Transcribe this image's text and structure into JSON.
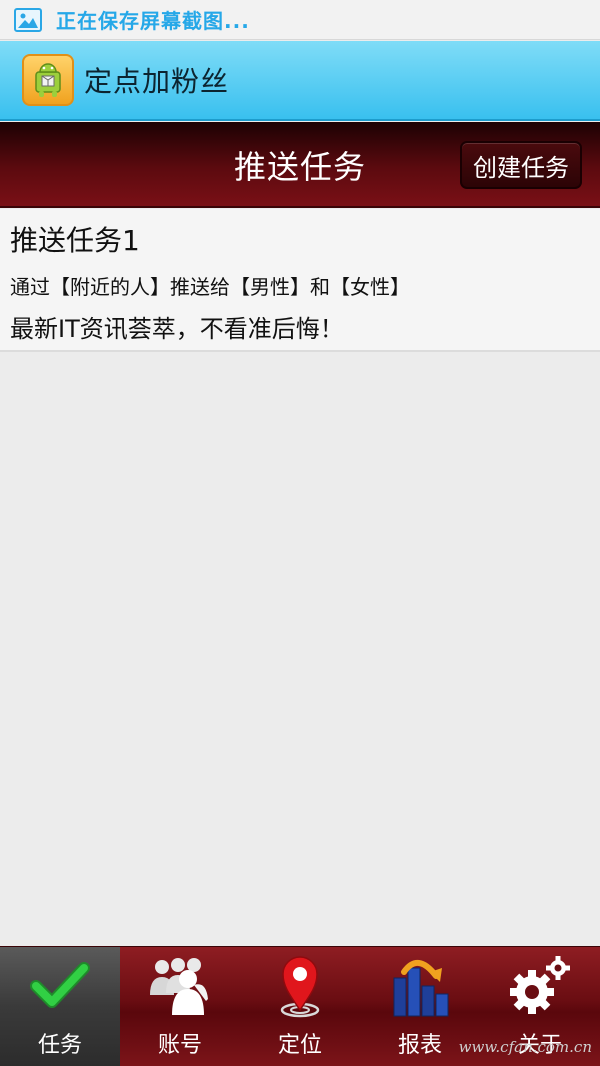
{
  "status_bar": {
    "icon": "image-icon",
    "text": "正在保存屏幕截图..."
  },
  "app": {
    "logo": "android-box-icon",
    "title": "定点加粉丝"
  },
  "header": {
    "title": "推送任务",
    "create_button": "创建任务"
  },
  "tasks": [
    {
      "name": "推送任务1",
      "description": "通过【附近的人】推送给【男性】和【女性】",
      "message": "最新IT资讯荟萃，不看准后悔！"
    }
  ],
  "nav": {
    "items": [
      {
        "label": "任务",
        "icon": "checkmark-icon",
        "active": true
      },
      {
        "label": "账号",
        "icon": "people-icon",
        "active": false
      },
      {
        "label": "定位",
        "icon": "location-pin-icon",
        "active": false
      },
      {
        "label": "报表",
        "icon": "bar-chart-icon",
        "active": false
      },
      {
        "label": "关于",
        "icon": "gears-icon",
        "active": false
      }
    ]
  },
  "watermark": "www.cfan.com.cn",
  "colors": {
    "status_text": "#26a8e8",
    "app_bar": "#39c0ef",
    "header": "#5c0a0f",
    "nav": "#6a0d12",
    "check": "#29c23a",
    "pin": "#e0161c"
  }
}
